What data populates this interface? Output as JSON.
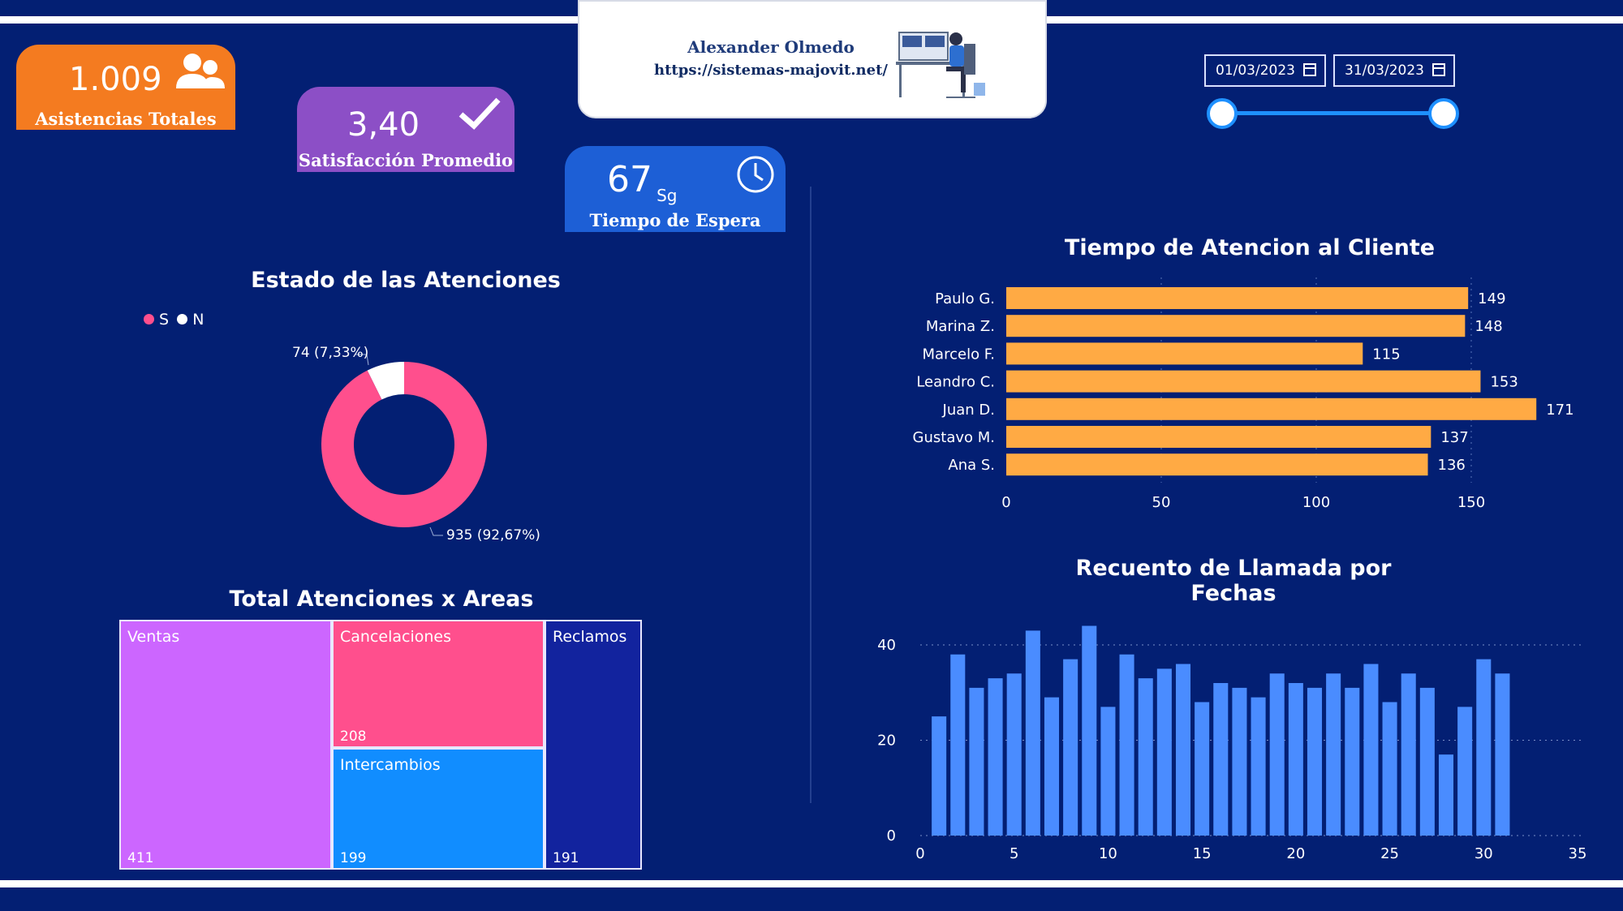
{
  "header": {
    "author": "Alexander Olmedo",
    "site": "https://sistemas-majovit.net/"
  },
  "kpis": {
    "total": {
      "value": "1.009",
      "label": "Asistencias Totales",
      "icon": "users-icon",
      "color": "#f47b20"
    },
    "satisfaction": {
      "value": "3,40",
      "label": "Satisfacción Promedio",
      "icon": "check-icon",
      "color": "#8c4fc6"
    },
    "wait": {
      "value": "67",
      "unit": "Sg",
      "label": "Tiempo de Espera",
      "icon": "clock-icon",
      "color": "#1d5fd6"
    }
  },
  "date_filter": {
    "start": "01/03/2023",
    "end": "31/03/2023"
  },
  "donut": {
    "title": "Estado de las Atenciones",
    "legend": [
      "S",
      "N"
    ],
    "label_small": "74 (7,33%)",
    "label_large": "935 (92,67%)"
  },
  "treemap": {
    "title": "Total Atenciones x Areas",
    "cells": [
      {
        "name": "Ventas",
        "value": "411",
        "color": "#cc66ff"
      },
      {
        "name": "Cancelaciones",
        "value": "208",
        "color": "#ff4f8d"
      },
      {
        "name": "Intercambios",
        "value": "199",
        "color": "#118dff"
      },
      {
        "name": "Reclamos",
        "value": "191",
        "color": "#12239e"
      }
    ]
  },
  "chart_data": [
    {
      "type": "pie",
      "title": "Estado de las Atenciones",
      "categories": [
        "S",
        "N"
      ],
      "values": [
        935,
        74
      ],
      "labels": [
        "935 (92,67%)",
        "74 (7,33%)"
      ],
      "colors": [
        "#ff4f8d",
        "#ffffff"
      ],
      "legend": "top-left"
    },
    {
      "type": "bar",
      "orientation": "horizontal",
      "title": "Tiempo de Atencion al Cliente",
      "categories": [
        "Paulo G.",
        "Marina Z.",
        "Marcelo F.",
        "Leandro C.",
        "Juan D.",
        "Gustavo M.",
        "Ana S."
      ],
      "values": [
        149,
        148,
        115,
        153,
        171,
        137,
        136
      ],
      "xlim": [
        0,
        150
      ],
      "xticks": [
        0,
        50,
        100,
        150
      ],
      "grid": true,
      "color": "#ffaa44"
    },
    {
      "type": "bar",
      "title": "Recuento de Llamada por Fechas",
      "x": [
        1,
        2,
        3,
        4,
        5,
        6,
        7,
        8,
        9,
        10,
        11,
        12,
        13,
        14,
        15,
        16,
        17,
        18,
        19,
        20,
        21,
        22,
        23,
        24,
        25,
        26,
        27,
        28,
        29,
        30,
        31
      ],
      "values": [
        25,
        38,
        31,
        33,
        34,
        43,
        29,
        37,
        44,
        27,
        38,
        33,
        35,
        36,
        28,
        32,
        31,
        29,
        34,
        32,
        31,
        34,
        31,
        36,
        28,
        34,
        31,
        17,
        27,
        37,
        34
      ],
      "xlim": [
        0,
        35
      ],
      "ylim": [
        0,
        46
      ],
      "xticks": [
        0,
        5,
        10,
        15,
        20,
        25,
        30,
        35
      ],
      "yticks": [
        0,
        20,
        40
      ],
      "grid": true,
      "color": "#4a8cff"
    }
  ]
}
